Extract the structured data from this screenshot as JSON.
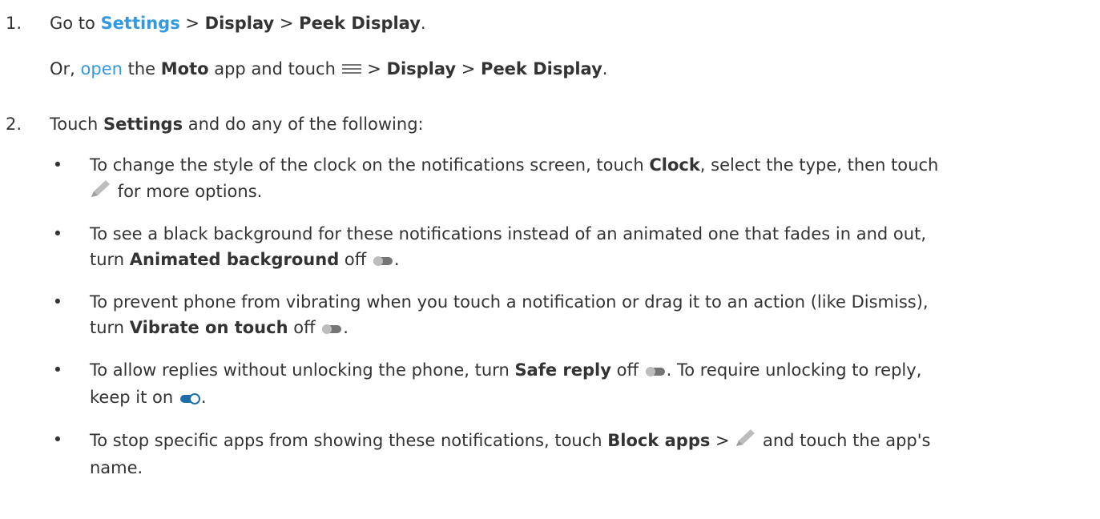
{
  "step1": {
    "num": "1.",
    "go_to": "Go to ",
    "settings_link": "Settings",
    "sep": " > ",
    "display": "Display",
    "peek": "Peek Display",
    "end": ".",
    "alt_or": "Or, ",
    "open_link": "open",
    "alt_the": " the ",
    "moto": "Moto",
    "alt_app_touch": " app and touch ",
    "menu_icon": "menu-icon"
  },
  "step2": {
    "num": "2.",
    "touch": "Touch ",
    "settings": "Settings",
    "rest": " and do any of the following:"
  },
  "bullets": {
    "b1": {
      "t1": "To change the style of the clock on the notifications screen, touch ",
      "clock": "Clock",
      "t2": ", select the type, then touch",
      "t3": " for more options.",
      "icon": "pencil-icon"
    },
    "b2": {
      "t1": "To see a black background for these notifications instead of an animated one that fades in and out,",
      "t2": "turn ",
      "bold": "Animated background",
      "t3": " off ",
      "end": ".",
      "icon": "toggle-off-icon"
    },
    "b3": {
      "t1": "To prevent phone from vibrating when you touch a notification or drag it to an action (like Dismiss),",
      "t2": "turn ",
      "bold": "Vibrate on touch",
      "t3": " off ",
      "end": ".",
      "icon": "toggle-off-icon"
    },
    "b4": {
      "t1": "To allow replies without unlocking the phone, turn ",
      "bold": "Safe reply",
      "t2": " off ",
      "t3": ". To require unlocking to reply,",
      "t4": "keep it on ",
      "end": ".",
      "icon_off": "toggle-off-icon",
      "icon_on": "toggle-on-icon"
    },
    "b5": {
      "t1": "To stop specific apps from showing these notifications, touch ",
      "bold": "Block apps",
      "t2": " > ",
      "t3": " and touch the app's",
      "t4": "name.",
      "icon": "pencil-icon"
    }
  },
  "colors": {
    "text": "#333333",
    "link": "#3399e0",
    "toggle_off": "#757575",
    "toggle_on": "#1e6fa8",
    "pencil": "#bdbdbd"
  }
}
